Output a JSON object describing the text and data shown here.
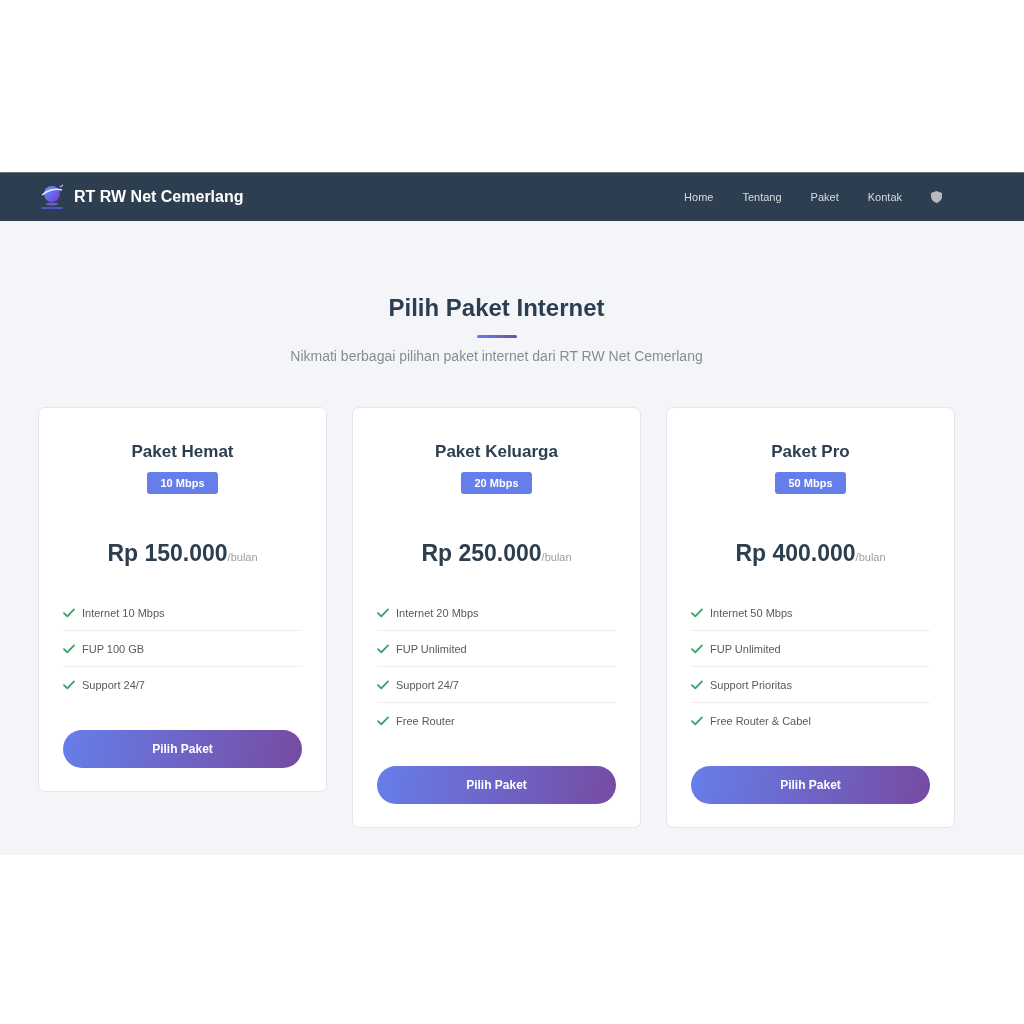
{
  "navbar": {
    "brand": "RT RW Net Cemerlang",
    "links": [
      {
        "label": "Home"
      },
      {
        "label": "Tentang"
      },
      {
        "label": "Paket"
      },
      {
        "label": "Kontak"
      }
    ]
  },
  "section": {
    "title": "Pilih Paket Internet",
    "subtitle": "Nikmati berbagai pilihan paket internet dari RT RW Net Cemerlang"
  },
  "plans": [
    {
      "name": "Paket Hemat",
      "speed": "10 Mbps",
      "price": "Rp 150.000",
      "period": "/bulan",
      "features": [
        "Internet 10 Mbps",
        "FUP 100 GB",
        "Support 24/7"
      ],
      "button": "Pilih Paket"
    },
    {
      "name": "Paket Keluarga",
      "speed": "20 Mbps",
      "price": "Rp 250.000",
      "period": "/bulan",
      "features": [
        "Internet 20 Mbps",
        "FUP Unlimited",
        "Support 24/7",
        "Free Router"
      ],
      "button": "Pilih Paket"
    },
    {
      "name": "Paket Pro",
      "speed": "50 Mbps",
      "price": "Rp 400.000",
      "period": "/bulan",
      "features": [
        "Internet 50 Mbps",
        "FUP Unlimited",
        "Support Prioritas",
        "Free Router & Cabel"
      ],
      "button": "Pilih Paket"
    }
  ]
}
